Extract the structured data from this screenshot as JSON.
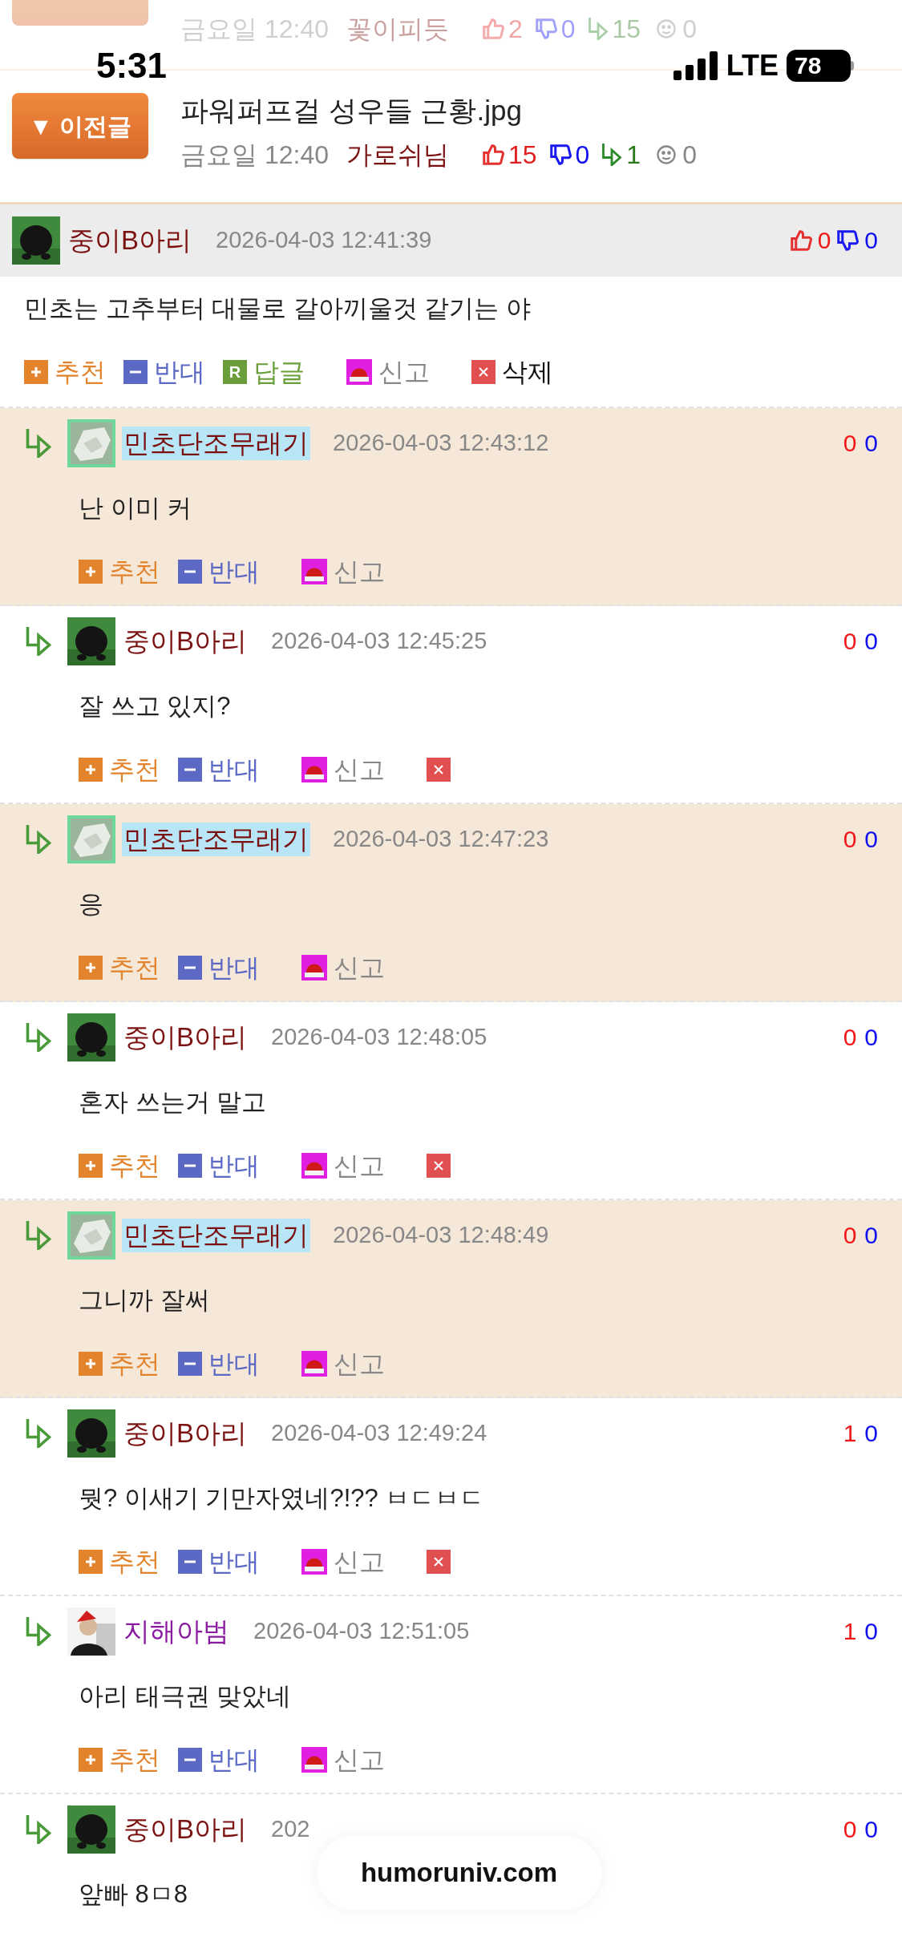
{
  "faded_post": {
    "date": "금요일 12:40",
    "author": "꽃이피듯",
    "likes": "2",
    "dislikes": "0",
    "replies": "15",
    "views": "0"
  },
  "status_bar": {
    "time": "5:31",
    "network": "LTE",
    "battery": "78"
  },
  "prev_post": {
    "button": "▼ 이전글",
    "title": "파워퍼프걸 성우들 근황.jpg",
    "date": "금요일 12:40",
    "author": "가로쉬님",
    "likes": "15",
    "dislikes": "0",
    "replies": "1",
    "views": "0"
  },
  "comment": {
    "author": "중이B아리",
    "avatar": {
      "kind": "blob"
    },
    "date": "2026-04-03 12:41:39",
    "likes": "0",
    "dislikes": "0",
    "text": "민초는 고추부터 대물로 갈아끼울것 같기는 야",
    "actions": [
      {
        "kind": "up",
        "label": "추천"
      },
      {
        "kind": "down",
        "label": "반대"
      },
      {
        "kind": "reply",
        "badge": "R",
        "label": "답글"
      },
      {
        "kind": "report",
        "label": "신고"
      },
      {
        "kind": "delete",
        "label": "삭제"
      }
    ]
  },
  "replies": [
    {
      "author": "민초단조무래기",
      "avatar": {
        "kind": "rock"
      },
      "highlighted": true,
      "color": "#7a1010",
      "date": "2026-04-03 12:43:12",
      "likes": "0",
      "dislikes": "0",
      "text": "난 이미 커",
      "deletable": false,
      "actions": [
        {
          "kind": "up",
          "label": "추천"
        },
        {
          "kind": "down",
          "label": "반대"
        },
        {
          "kind": "report",
          "label": "신고"
        }
      ]
    },
    {
      "author": "중이B아리",
      "avatar": {
        "kind": "blob"
      },
      "highlighted": false,
      "color": "#7a1010",
      "date": "2026-04-03 12:45:25",
      "likes": "0",
      "dislikes": "0",
      "text": "잘 쓰고 있지?",
      "deletable": true,
      "actions": [
        {
          "kind": "up",
          "label": "추천"
        },
        {
          "kind": "down",
          "label": "반대"
        },
        {
          "kind": "report",
          "label": "신고"
        }
      ]
    },
    {
      "author": "민초단조무래기",
      "avatar": {
        "kind": "rock"
      },
      "highlighted": true,
      "color": "#7a1010",
      "date": "2026-04-03 12:47:23",
      "likes": "0",
      "dislikes": "0",
      "text": "응",
      "deletable": false,
      "actions": [
        {
          "kind": "up",
          "label": "추천"
        },
        {
          "kind": "down",
          "label": "반대"
        },
        {
          "kind": "report",
          "label": "신고"
        }
      ]
    },
    {
      "author": "중이B아리",
      "avatar": {
        "kind": "blob"
      },
      "highlighted": false,
      "color": "#7a1010",
      "date": "2026-04-03 12:48:05",
      "likes": "0",
      "dislikes": "0",
      "text": "혼자 쓰는거 말고",
      "deletable": true,
      "actions": [
        {
          "kind": "up",
          "label": "추천"
        },
        {
          "kind": "down",
          "label": "반대"
        },
        {
          "kind": "report",
          "label": "신고"
        }
      ]
    },
    {
      "author": "민초단조무래기",
      "avatar": {
        "kind": "rock"
      },
      "highlighted": true,
      "color": "#7a1010",
      "date": "2026-04-03 12:48:49",
      "likes": "0",
      "dislikes": "0",
      "text": "그니까 잘써",
      "deletable": false,
      "actions": [
        {
          "kind": "up",
          "label": "추천"
        },
        {
          "kind": "down",
          "label": "반대"
        },
        {
          "kind": "report",
          "label": "신고"
        }
      ]
    },
    {
      "author": "중이B아리",
      "avatar": {
        "kind": "blob"
      },
      "highlighted": false,
      "color": "#7a1010",
      "date": "2026-04-03 12:49:24",
      "likes": "1",
      "dislikes": "0",
      "text": "뭣? 이새기 기만자였네?!?? ㅂㄷㅂㄷ",
      "deletable": true,
      "actions": [
        {
          "kind": "up",
          "label": "추천"
        },
        {
          "kind": "down",
          "label": "반대"
        },
        {
          "kind": "report",
          "label": "신고"
        }
      ]
    },
    {
      "author": "지해아범",
      "avatar": {
        "kind": "person"
      },
      "highlighted": false,
      "color": "#8a1aa0",
      "date": "2026-04-03 12:51:05",
      "likes": "1",
      "dislikes": "0",
      "text": "아리 태극권 맞았네",
      "deletable": false,
      "actions": [
        {
          "kind": "up",
          "label": "추천"
        },
        {
          "kind": "down",
          "label": "반대"
        },
        {
          "kind": "report",
          "label": "신고"
        }
      ]
    },
    {
      "author": "중이B아리",
      "avatar": {
        "kind": "blob"
      },
      "highlighted": false,
      "color": "#7a1010",
      "date": "202",
      "likes": "0",
      "dislikes": "0",
      "text": "앞빠 8ㅁ8"
    }
  ],
  "toast": "humoruniv.com"
}
